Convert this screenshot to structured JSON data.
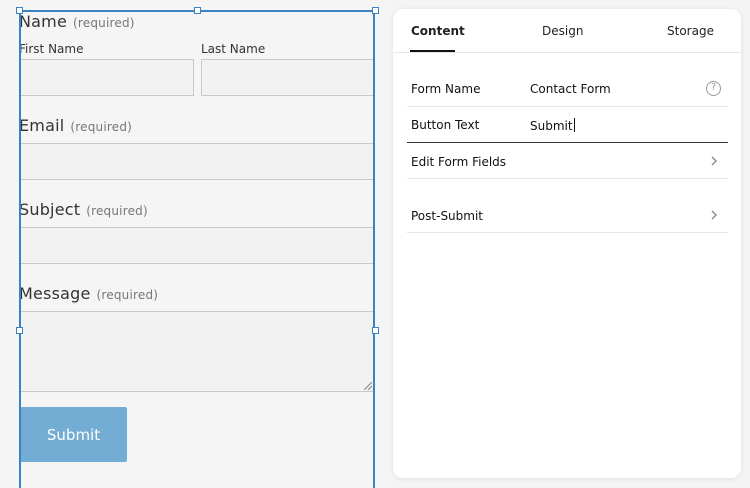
{
  "form_preview": {
    "name_label": "Name",
    "name_required": "(required)",
    "first_name_label": "First Name",
    "last_name_label": "Last Name",
    "email_label": "Email",
    "email_required": "(required)",
    "subject_label": "Subject",
    "subject_required": "(required)",
    "message_label": "Message",
    "message_required": "(required)",
    "submit_label": "Submit"
  },
  "panel": {
    "tabs": [
      {
        "label": "Content",
        "active": true
      },
      {
        "label": "Design",
        "active": false
      },
      {
        "label": "Storage",
        "active": false
      }
    ],
    "form_name": {
      "label": "Form Name",
      "value": "Contact Form"
    },
    "button_text": {
      "label": "Button Text",
      "value": "Submit"
    },
    "edit_fields": {
      "label": "Edit Form Fields"
    },
    "post_submit": {
      "label": "Post-Submit"
    }
  },
  "colors": {
    "selection": "#3b82c4",
    "submit_button": "#74add4"
  },
  "icons": {
    "help": "question-circle-icon",
    "chevron": "chevron-right-icon"
  }
}
